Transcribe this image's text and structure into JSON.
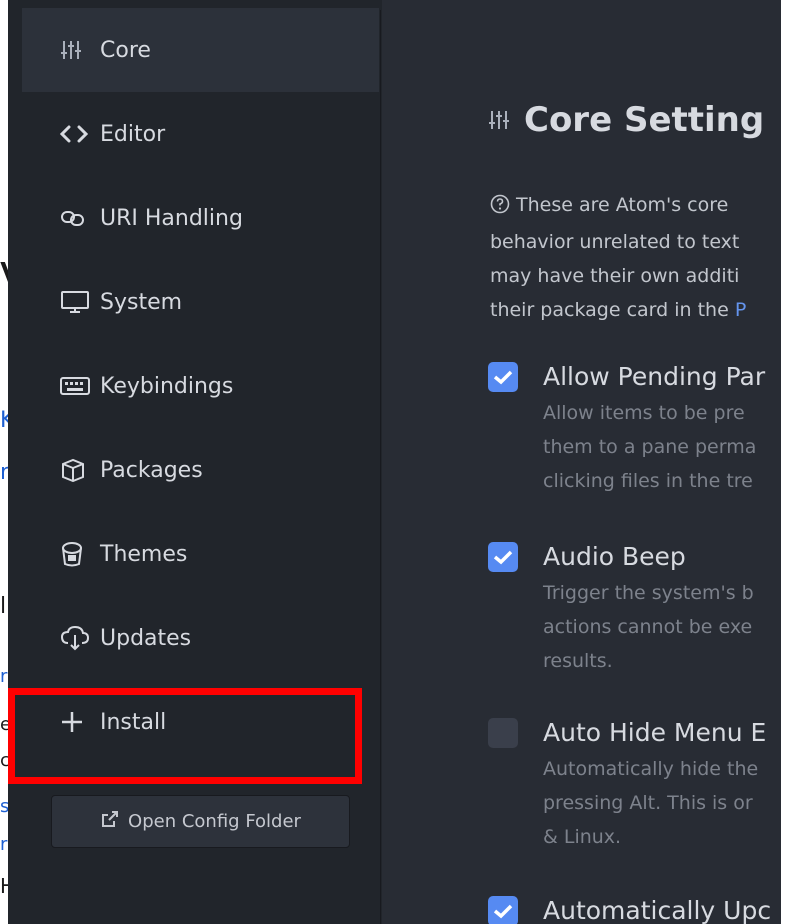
{
  "background_window": {
    "fragments": [
      "V",
      "K",
      "n",
      "l",
      "r",
      "e",
      "c",
      "s",
      "r",
      "H"
    ]
  },
  "sidebar": {
    "items": [
      {
        "label": "Core",
        "icon": "settings-sliders-icon",
        "active": true
      },
      {
        "label": "Editor",
        "icon": "code-icon",
        "active": false
      },
      {
        "label": "URI Handling",
        "icon": "link-icon",
        "active": false
      },
      {
        "label": "System",
        "icon": "monitor-icon",
        "active": false
      },
      {
        "label": "Keybindings",
        "icon": "keyboard-icon",
        "active": false
      },
      {
        "label": "Packages",
        "icon": "package-icon",
        "active": false
      },
      {
        "label": "Themes",
        "icon": "paintcan-icon",
        "active": false
      },
      {
        "label": "Updates",
        "icon": "cloud-download-icon",
        "active": false
      },
      {
        "label": "Install",
        "icon": "plus-icon",
        "active": false
      }
    ],
    "open_config_label": "Open Config Folder"
  },
  "main": {
    "title": "Core Setting",
    "description_lines": [
      "These are Atom's core",
      "behavior unrelated to text",
      "may have their own additi",
      "their package card in the "
    ],
    "description_link": "P",
    "settings": [
      {
        "title": "Allow Pending Par",
        "checked": true,
        "desc": [
          "Allow items to be pre",
          "them to a pane perma",
          "clicking files in the tre"
        ]
      },
      {
        "title": "Audio Beep",
        "checked": true,
        "desc": [
          "Trigger the system's b",
          "actions cannot be exe",
          "results."
        ]
      },
      {
        "title": "Auto Hide Menu E",
        "checked": false,
        "desc": [
          "Automatically hide the",
          "pressing Alt. This is or",
          "& Linux."
        ]
      },
      {
        "title": "Automatically Upc",
        "checked": true,
        "desc": []
      }
    ]
  },
  "colors": {
    "accent": "#568af2",
    "highlight": "#ff0000",
    "sidebar_bg": "#21252b",
    "main_bg": "#282c34"
  }
}
